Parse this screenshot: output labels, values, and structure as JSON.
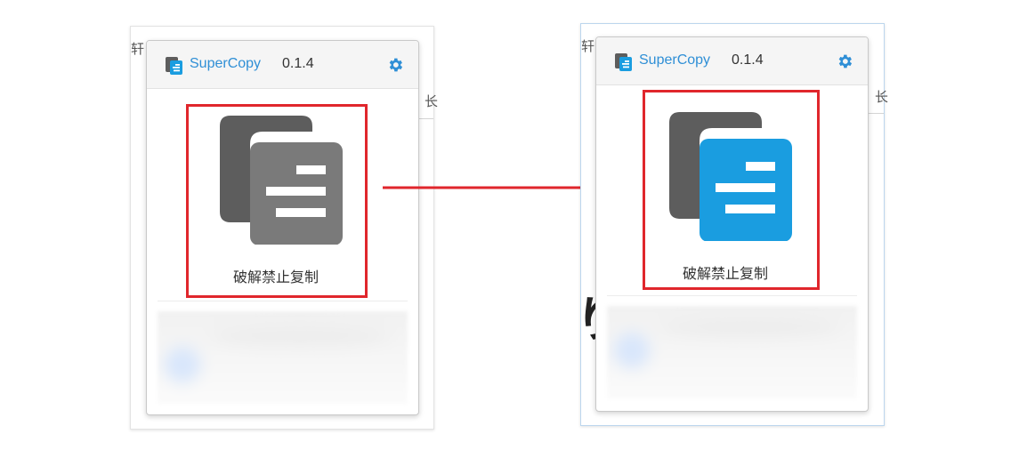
{
  "popup_before": {
    "app_name": "SuperCopy",
    "version": "0.1.4",
    "action_label": "破解禁止复制",
    "icon_state": "inactive-gray"
  },
  "popup_after": {
    "app_name": "SuperCopy",
    "version": "0.1.4",
    "action_label": "破解禁止复制",
    "icon_state": "active-blue"
  },
  "background_fragments": {
    "left_glyph_top": "轩",
    "left_glyph_side": "长",
    "right_glyph_top": "轩",
    "right_glyph_side": "长",
    "right_big_char": "り"
  },
  "colors": {
    "brand_blue": "#2f8fd6",
    "active_icon_blue": "#1a9de0",
    "inactive_icon_gray": "#7a7a7a",
    "back_page_gray": "#5d5d5d",
    "highlight_red": "#e0262c"
  },
  "icons": {
    "brand": "document-copy-icon",
    "settings": "gear-icon",
    "action": "copy-documents-icon",
    "transition": "arrow-right-icon"
  }
}
